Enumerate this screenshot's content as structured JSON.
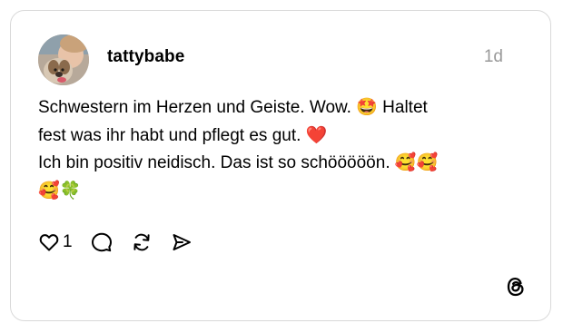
{
  "post": {
    "username": "tattybabe",
    "timestamp": "1d",
    "lines": [
      "Schwestern im Herzen und Geiste. Wow. 🤩 Haltet",
      "fest was ihr habt und pflegt es gut. ❤️",
      "Ich bin positiv neidisch. Das ist so schööööön. 🥰🥰",
      "🥰🍀"
    ]
  },
  "actions": {
    "like_count": "1"
  },
  "icons": {
    "like": "heart-icon",
    "comment": "comment-bubble-icon",
    "repost": "repost-icon",
    "share": "send-icon",
    "brand": "threads-logo-icon"
  },
  "colors": {
    "border": "#d9d9d9",
    "timestamp": "#999999",
    "text": "#000000"
  }
}
